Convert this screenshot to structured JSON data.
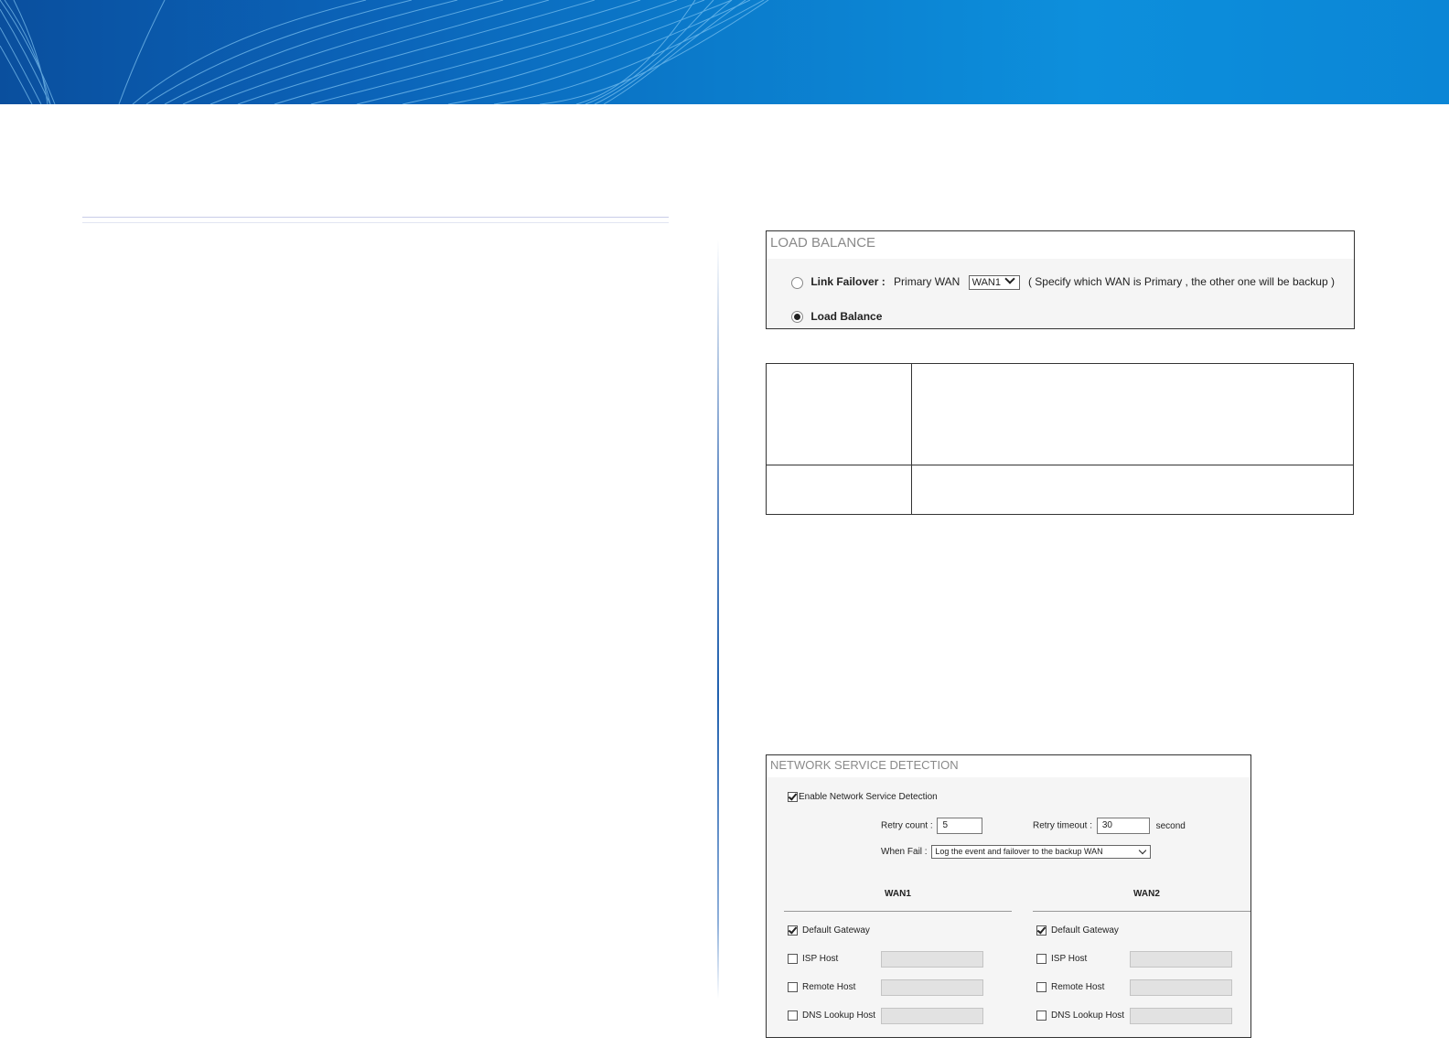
{
  "load_balance_panel": {
    "title": "LOAD BALANCE",
    "link_failover_label": "Link Failover :",
    "primary_wan_label": "Primary WAN",
    "primary_wan_value": "WAN1",
    "hint": "( Specify which WAN is Primary , the other one will be backup )",
    "load_balance_label": "Load Balance",
    "selected_mode": "Load Balance"
  },
  "network_service_detection_panel": {
    "title": "NETWORK SERVICE DETECTION",
    "enable_label": "Enable Network Service Detection",
    "enable_checked": true,
    "retry_count_label": "Retry count :",
    "retry_count_value": "5",
    "retry_timeout_label": "Retry timeout :",
    "retry_timeout_value": "30",
    "retry_timeout_unit": "second",
    "when_fail_label": "When Fail :",
    "when_fail_value": "Log the event and failover to the backup WAN",
    "wan1": {
      "heading": "WAN1",
      "default_gateway": "Default Gateway",
      "isp_host": "ISP Host",
      "remote_host": "Remote Host",
      "dns_lookup_host": "DNS Lookup Host"
    },
    "wan2": {
      "heading": "WAN2",
      "default_gateway": "Default Gateway",
      "isp_host": "ISP Host",
      "remote_host": "Remote Host",
      "dns_lookup_host": "DNS Lookup Host"
    }
  },
  "colors": {
    "banner_dark": "#0a4f9e",
    "banner_light": "#0d8fdc",
    "panel_bg": "#f5f5f5"
  }
}
